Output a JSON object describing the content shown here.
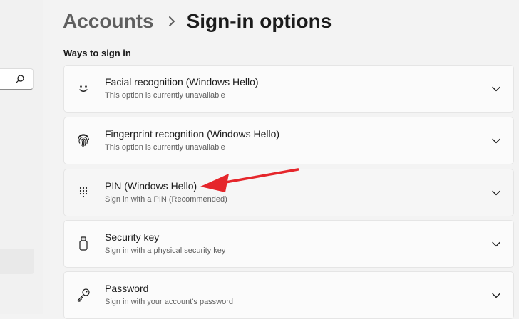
{
  "breadcrumb": {
    "parent": "Accounts",
    "current": "Sign-in options"
  },
  "section_title": "Ways to sign in",
  "options": [
    {
      "title": "Facial recognition (Windows Hello)",
      "subtitle": "This option is currently unavailable",
      "icon": "face-icon"
    },
    {
      "title": "Fingerprint recognition (Windows Hello)",
      "subtitle": "This option is currently unavailable",
      "icon": "fingerprint-icon"
    },
    {
      "title": "PIN (Windows Hello)",
      "subtitle": "Sign in with a PIN (Recommended)",
      "icon": "pin-keypad-icon"
    },
    {
      "title": "Security key",
      "subtitle": "Sign in with a physical security key",
      "icon": "usb-key-icon"
    },
    {
      "title": "Password",
      "subtitle": "Sign in with your account's password",
      "icon": "key-icon"
    }
  ],
  "colors": {
    "background": "#f3f3f3",
    "card": "#fbfbfb",
    "annotation_arrow": "#e5262b"
  }
}
